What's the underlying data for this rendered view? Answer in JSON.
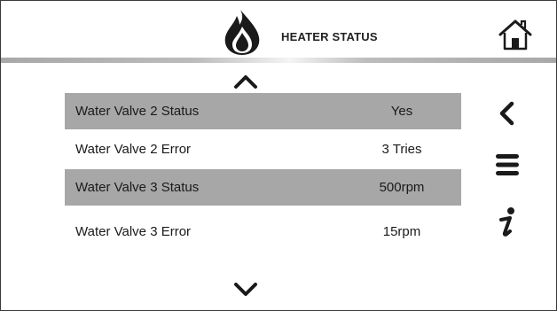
{
  "header": {
    "title": "HEATER STATUS",
    "flame_icon": "flame-icon",
    "home_icon": "home-icon"
  },
  "navigation": {
    "scroll_up_icon": "chevron-up-icon",
    "scroll_down_icon": "chevron-down-icon",
    "back_icon": "chevron-left-icon",
    "menu_icon": "hamburger-menu-icon",
    "info_icon": "info-icon"
  },
  "rows": [
    {
      "label": "Water Valve 2 Status",
      "value": "Yes"
    },
    {
      "label": "Water Valve 2 Error",
      "value": "3 Tries"
    },
    {
      "label": "Water Valve 3 Status",
      "value": "500rpm"
    },
    {
      "label": "Water Valve 3 Error",
      "value": "15rpm"
    }
  ],
  "colors": {
    "row_highlight": "#a7a7a7",
    "border": "#3a3a3a",
    "icon": "#1a1a1a"
  }
}
